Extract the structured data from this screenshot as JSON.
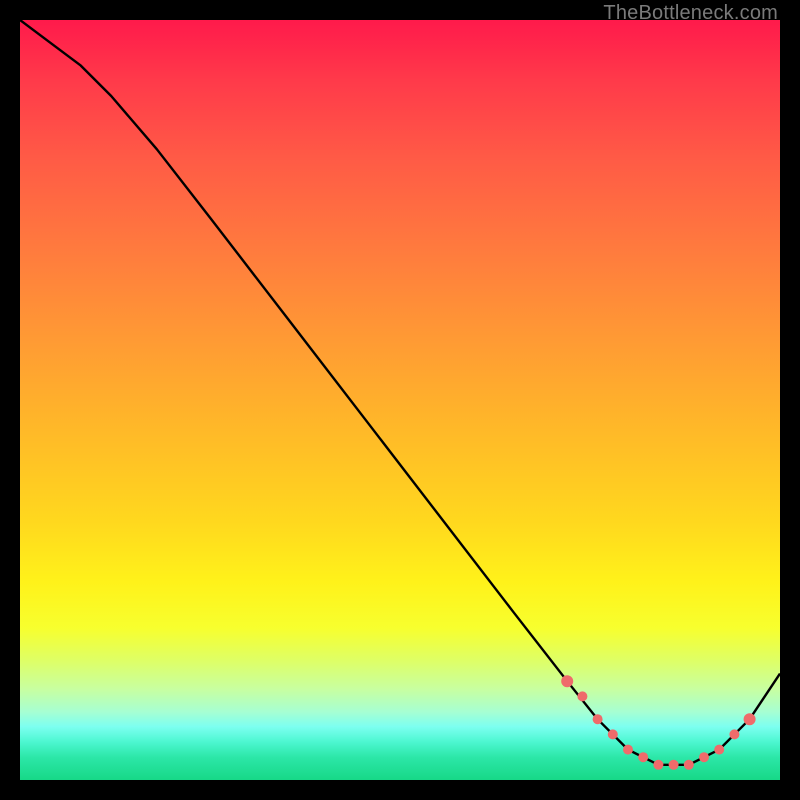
{
  "watermark": "TheBottleneck.com",
  "chart_data": {
    "type": "line",
    "title": "",
    "xlabel": "",
    "ylabel": "",
    "xlim": [
      0,
      100
    ],
    "ylim": [
      0,
      100
    ],
    "grid": false,
    "legend": false,
    "series": [
      {
        "name": "bottleneck-curve",
        "color": "#000000",
        "x": [
          0,
          4,
          8,
          12,
          18,
          25,
          35,
          45,
          55,
          65,
          72,
          76,
          80,
          84,
          88,
          92,
          96,
          100
        ],
        "y": [
          100,
          97,
          94,
          90,
          83,
          74,
          61,
          48,
          35,
          22,
          13,
          8,
          4,
          2,
          2,
          4,
          8,
          14
        ]
      }
    ],
    "markers": {
      "name": "highlight-dots",
      "color": "#ef6b6b",
      "shape": "circle",
      "x": [
        72,
        74,
        76,
        78,
        80,
        82,
        84,
        86,
        88,
        90,
        92,
        94,
        96
      ],
      "y": [
        13,
        11,
        8,
        6,
        4,
        3,
        2,
        2,
        2,
        3,
        4,
        6,
        8
      ]
    },
    "background": {
      "type": "vertical-gradient",
      "stops": [
        {
          "pos": 0.0,
          "color": "#ff1a4b"
        },
        {
          "pos": 0.3,
          "color": "#ff7a3e"
        },
        {
          "pos": 0.66,
          "color": "#ffd81e"
        },
        {
          "pos": 0.8,
          "color": "#f7ff2e"
        },
        {
          "pos": 0.93,
          "color": "#7cfff0"
        },
        {
          "pos": 1.0,
          "color": "#17d887"
        }
      ]
    }
  }
}
